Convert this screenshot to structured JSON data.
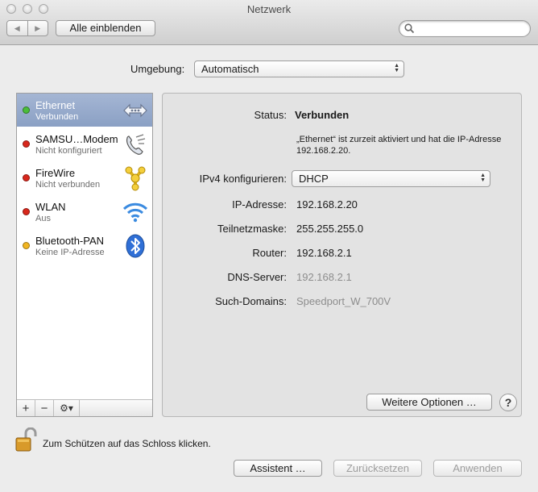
{
  "window": {
    "title": "Netzwerk"
  },
  "toolbar": {
    "show_all": "Alle einblenden",
    "search_placeholder": ""
  },
  "location": {
    "label": "Umgebung:",
    "value": "Automatisch"
  },
  "services": [
    {
      "name": "Ethernet",
      "status": "Verbunden",
      "dot": "#4bbd3a",
      "icon": "ethernet-icon",
      "selected": true
    },
    {
      "name": "SAMSU…Modem",
      "status": "Nicht konfiguriert",
      "dot": "#d8271c",
      "icon": "phone-icon"
    },
    {
      "name": "FireWire",
      "status": "Nicht verbunden",
      "dot": "#d8271c",
      "icon": "firewire-icon"
    },
    {
      "name": "WLAN",
      "status": "Aus",
      "dot": "#d8271c",
      "icon": "wifi-icon"
    },
    {
      "name": "Bluetooth-PAN",
      "status": "Keine IP-Adresse",
      "dot": "#f1b521",
      "icon": "bluetooth-icon"
    }
  ],
  "sidebar_buttons": {
    "add": "+",
    "remove": "−",
    "action": "⚙▾"
  },
  "detail": {
    "status_label": "Status:",
    "status_value": "Verbunden",
    "status_note": "„Ethernet“ ist zurzeit aktiviert und hat die IP-Adresse 192.168.2.20.",
    "ipv4_label": "IPv4 konfigurieren:",
    "ipv4_value": "DHCP",
    "ip_label": "IP-Adresse:",
    "ip_value": "192.168.2.20",
    "mask_label": "Teilnetzmaske:",
    "mask_value": "255.255.255.0",
    "router_label": "Router:",
    "router_value": "192.168.2.1",
    "dns_label": "DNS-Server:",
    "dns_value": "192.168.2.1",
    "domains_label": "Such-Domains:",
    "domains_value": "Speedport_W_700V",
    "more_options": "Weitere Optionen …",
    "help": "?"
  },
  "footer": {
    "lock_text": "Zum Schützen auf das Schloss klicken.",
    "assistant": "Assistent …",
    "revert": "Zurücksetzen",
    "apply": "Anwenden"
  },
  "colors": {
    "selection": "#8aa0c4",
    "panel": "#e3e3e3",
    "background": "#ececec"
  }
}
